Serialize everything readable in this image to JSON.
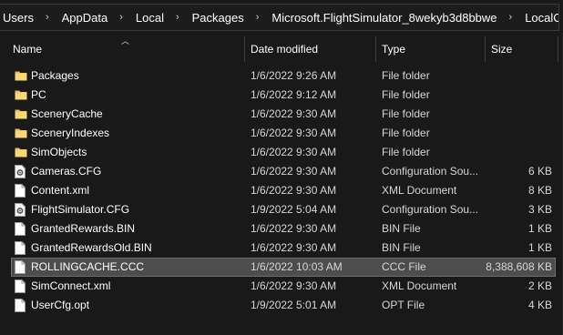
{
  "breadcrumb": [
    "Users",
    "AppData",
    "Local",
    "Packages",
    "Microsoft.FlightSimulator_8wekyb3d8bbwe",
    "LocalCache"
  ],
  "columns": {
    "name": "Name",
    "date": "Date modified",
    "type": "Type",
    "size": "Size"
  },
  "files": [
    {
      "name": "Packages",
      "date": "1/6/2022 9:26 AM",
      "type": "File folder",
      "size": "",
      "icon": "folder-icon"
    },
    {
      "name": "PC",
      "date": "1/6/2022 9:12 AM",
      "type": "File folder",
      "size": "",
      "icon": "folder-icon"
    },
    {
      "name": "SceneryCache",
      "date": "1/6/2022 9:30 AM",
      "type": "File folder",
      "size": "",
      "icon": "folder-icon"
    },
    {
      "name": "SceneryIndexes",
      "date": "1/6/2022 9:30 AM",
      "type": "File folder",
      "size": "",
      "icon": "folder-icon"
    },
    {
      "name": "SimObjects",
      "date": "1/6/2022 9:30 AM",
      "type": "File folder",
      "size": "",
      "icon": "folder-icon"
    },
    {
      "name": "Cameras.CFG",
      "date": "1/6/2022 9:30 AM",
      "type": "Configuration Sou...",
      "size": "6 KB",
      "icon": "config-file-icon"
    },
    {
      "name": "Content.xml",
      "date": "1/6/2022 9:30 AM",
      "type": "XML Document",
      "size": "8 KB",
      "icon": "file-icon"
    },
    {
      "name": "FlightSimulator.CFG",
      "date": "1/9/2022 5:04 AM",
      "type": "Configuration Sou...",
      "size": "3 KB",
      "icon": "config-file-icon"
    },
    {
      "name": "GrantedRewards.BIN",
      "date": "1/6/2022 9:30 AM",
      "type": "BIN File",
      "size": "1 KB",
      "icon": "file-icon"
    },
    {
      "name": "GrantedRewardsOld.BIN",
      "date": "1/6/2022 9:30 AM",
      "type": "BIN File",
      "size": "1 KB",
      "icon": "file-icon"
    },
    {
      "name": "ROLLINGCACHE.CCC",
      "date": "1/6/2022 10:03 AM",
      "type": "CCC File",
      "size": "8,388,608 KB",
      "icon": "file-icon",
      "selected": true
    },
    {
      "name": "SimConnect.xml",
      "date": "1/6/2022 9:30 AM",
      "type": "XML Document",
      "size": "2 KB",
      "icon": "file-icon"
    },
    {
      "name": "UserCfg.opt",
      "date": "1/9/2022 5:01 AM",
      "type": "OPT File",
      "size": "4 KB",
      "icon": "file-icon"
    }
  ],
  "colors": {
    "background": "#191919",
    "selection": "#4d4d4d",
    "folder": "#f8d775"
  }
}
